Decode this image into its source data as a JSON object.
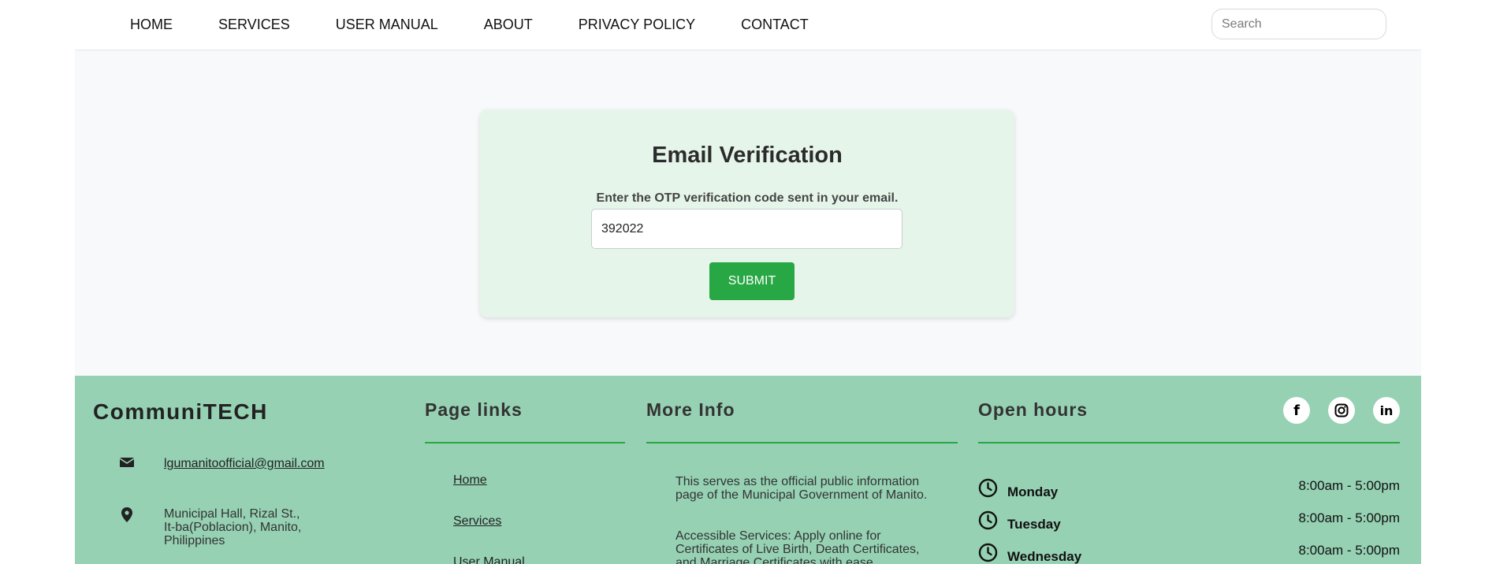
{
  "nav": {
    "links": [
      "HOME",
      "SERVICES",
      "USER MANUAL",
      "ABOUT",
      "PRIVACY POLICY",
      "CONTACT"
    ],
    "search_placeholder": "Search"
  },
  "verify": {
    "title": "Email Verification",
    "label": "Enter the OTP verification code sent in your email.",
    "otp_value": "392022",
    "submit_label": "SUBMIT"
  },
  "footer": {
    "brand": "CommuniTECH",
    "email": "lgumanitoofficial@gmail.com",
    "address_line1": "Municipal Hall, Rizal St.,",
    "address_line2": "It-ba(Poblacion), Manito,",
    "address_line3": "Philippines",
    "page_links_heading": "Page links",
    "page_links": [
      "Home",
      "Services",
      "User Manual"
    ],
    "more_info_heading": "More Info",
    "more_info": [
      {
        "line1": "This serves as the official public information",
        "line2": "page of the Municipal Government of Manito."
      },
      {
        "line1": "Accessible Services: Apply online for",
        "line2": "Certificates of Live Birth, Death Certificates,",
        "line3": "and Marriage Certificates with ease."
      }
    ],
    "open_hours_heading": "Open hours",
    "hours": [
      {
        "day": "Monday",
        "time": "8:00am - 5:00pm"
      },
      {
        "day": "Tuesday",
        "time": "8:00am - 5:00pm"
      },
      {
        "day": "Wednesday",
        "time": "8:00am - 5:00pm"
      }
    ],
    "social": {
      "facebook": "f",
      "instagram_icon": "instagram-icon",
      "linkedin": "in"
    }
  },
  "colors": {
    "accent_green": "#28a745",
    "footer_bg": "#96d1b3",
    "card_bg": "#e6f5ea"
  }
}
